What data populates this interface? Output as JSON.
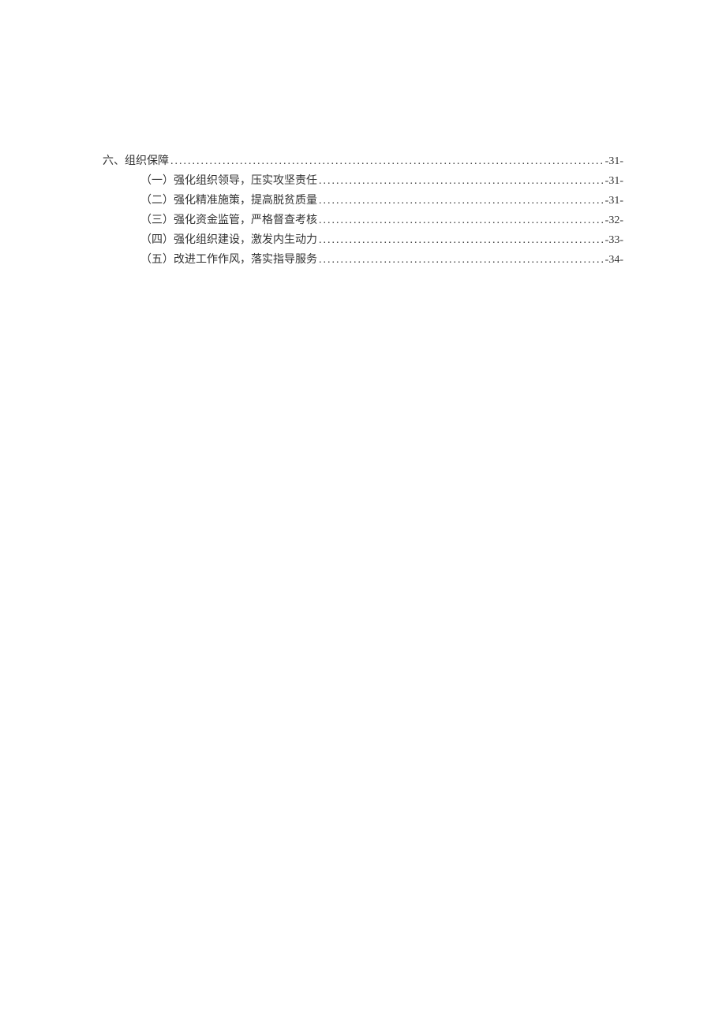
{
  "toc": {
    "items": [
      {
        "level": 1,
        "label": "六、组织保障",
        "page": "-31-"
      },
      {
        "level": 2,
        "label": "（一）强化组织领导，压实攻坚责任 ",
        "page": "-31-"
      },
      {
        "level": 2,
        "label": "（二）强化精准施策，提高脱贫质量 ",
        "page": "-31-"
      },
      {
        "level": 2,
        "label": "（三）强化资金监管，严格督查考核",
        "page": "-32-"
      },
      {
        "level": 2,
        "label": "（四）强化组织建设，激发内生动力 ",
        "page": "-33-"
      },
      {
        "level": 2,
        "label": "（五）改进工作作风，落实指导服务 ",
        "page": "-34-"
      }
    ]
  }
}
